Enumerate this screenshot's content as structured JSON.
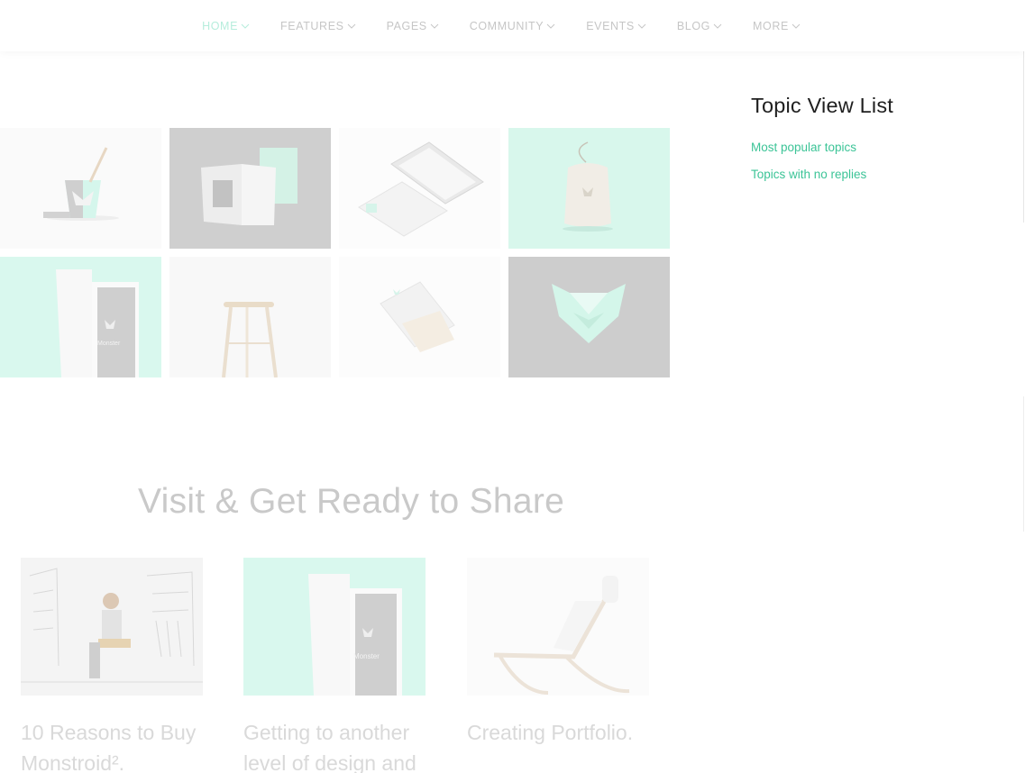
{
  "nav": {
    "items": [
      {
        "label": "HOME",
        "active": true
      },
      {
        "label": "FEATURES",
        "active": false
      },
      {
        "label": "PAGES",
        "active": false
      },
      {
        "label": "COMMUNITY",
        "active": false
      },
      {
        "label": "EVENTS",
        "active": false
      },
      {
        "label": "BLOG",
        "active": false
      },
      {
        "label": "MORE",
        "active": false
      }
    ],
    "chevron_icon": "chevron-down-icon",
    "active_color": "#b6eddc"
  },
  "gallery": {
    "tiles": [
      {
        "name": "cup-mockup"
      },
      {
        "name": "book-mockup"
      },
      {
        "name": "phone-mockup"
      },
      {
        "name": "bag-mockup"
      },
      {
        "name": "door-mockup"
      },
      {
        "name": "stool-mockup"
      },
      {
        "name": "paper-mockup"
      },
      {
        "name": "logo-mockup"
      }
    ],
    "door_caption": "Monster"
  },
  "section": {
    "title": "Visit & Get Ready to Share"
  },
  "posts": [
    {
      "title": "10 Reasons to Buy Monstroid².",
      "image": "man-sketch-image"
    },
    {
      "title": "Getting to another level of design and",
      "image": "door-image",
      "caption": "Monster"
    },
    {
      "title": "Creating Portfolio.",
      "image": "chair-image"
    }
  ],
  "sidebar": {
    "title": "Topic View List",
    "links": [
      "Most popular topics",
      "Topics with no replies"
    ],
    "link_color": "#3cc497"
  }
}
